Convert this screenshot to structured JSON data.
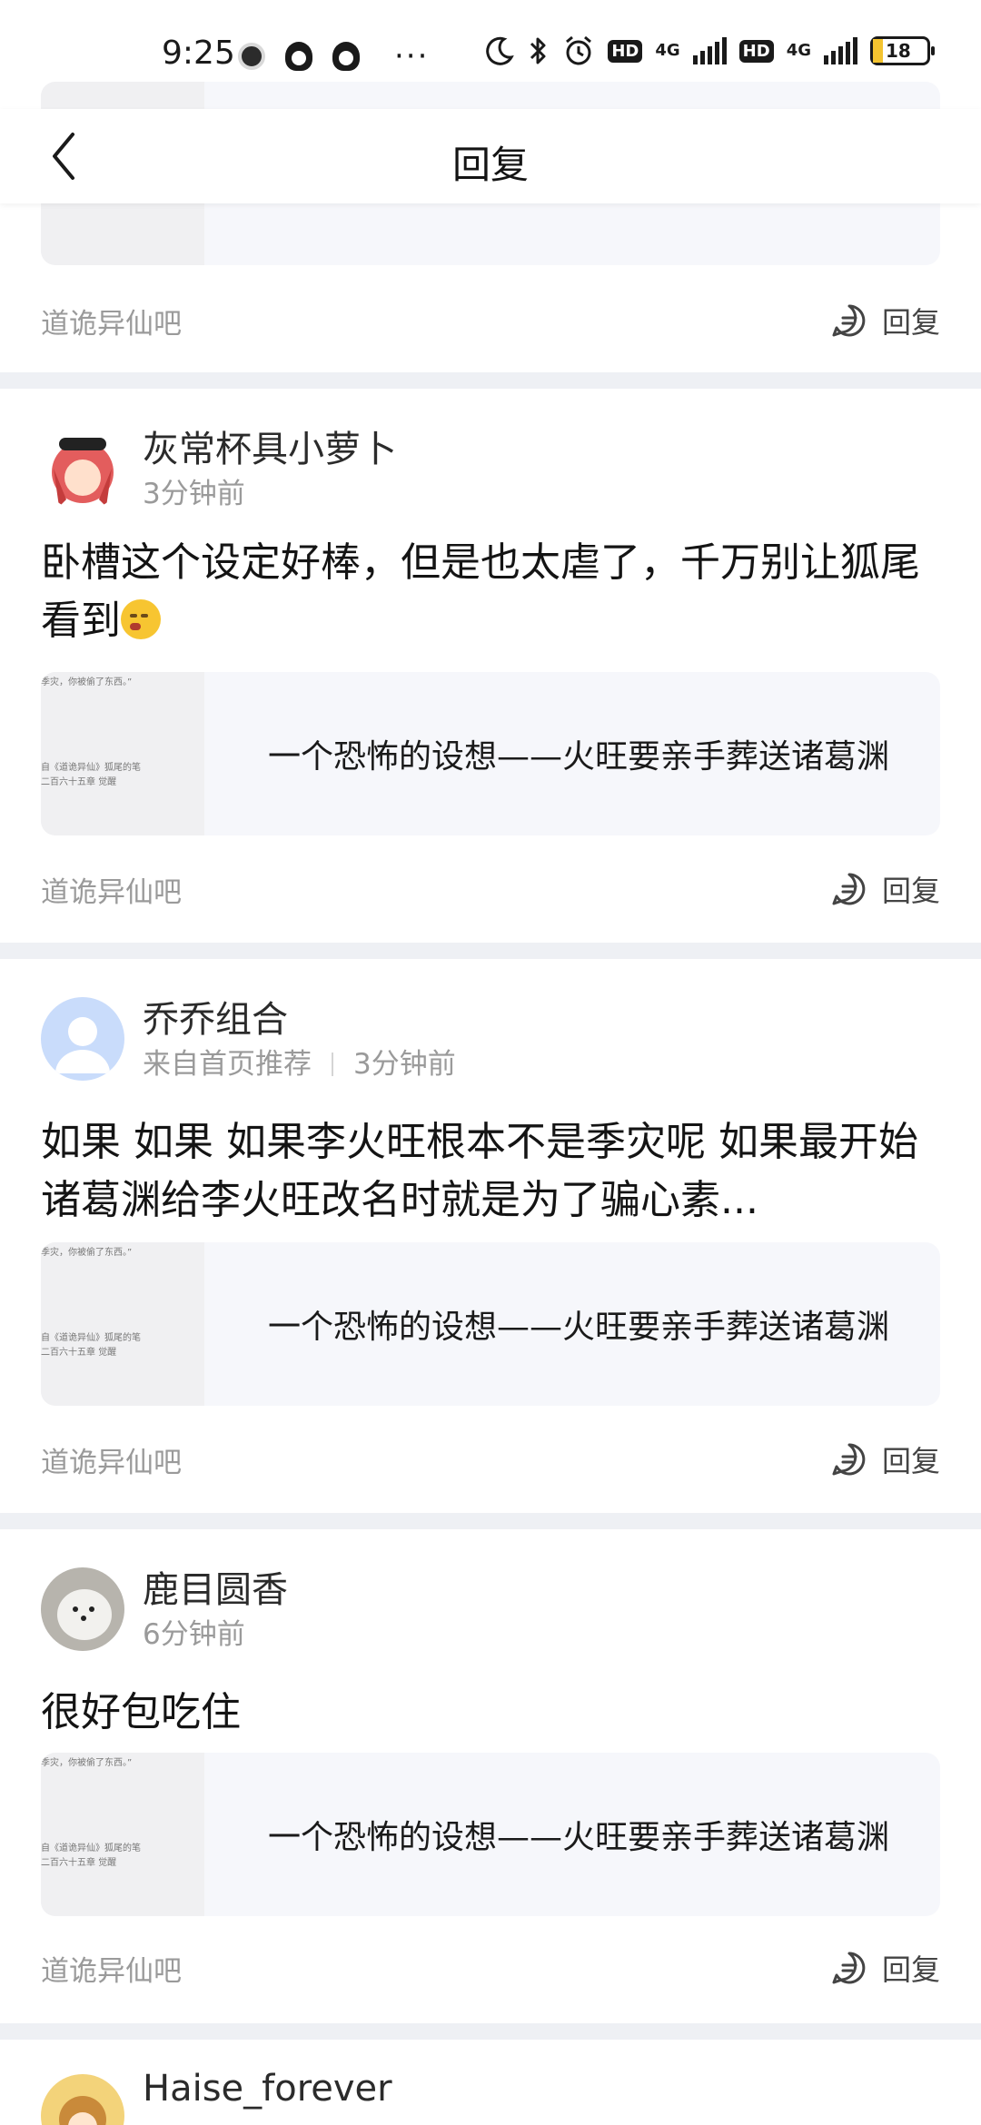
{
  "status_bar": {
    "time": "9:25",
    "more": "···",
    "hd1": "HD",
    "net1": "4G",
    "hd2": "HD",
    "net2": "4G",
    "battery_level": "18",
    "battery_fraction": 0.18
  },
  "header": {
    "title": "回复"
  },
  "quote_thumb": {
    "line1": "季灾，你被偷了东西。”",
    "line2": "自《道诡异仙》狐尾的笔",
    "line3": "二百六十五章 觉醒"
  },
  "cards": [
    {
      "quote_title": "",
      "forum": "道诡异仙吧",
      "reply_label": "回复"
    },
    {
      "username": "灰常杯具小萝卜",
      "source": "",
      "time": "3分钟前",
      "comment": "卧槽这个设定好棒，但是也太虐了，千万别让狐尾看到",
      "quote_title": "一个恐怖的设想——火旺要亲手葬送诸葛渊",
      "forum": "道诡异仙吧",
      "reply_label": "回复"
    },
    {
      "username": "乔乔组合",
      "source": "来自首页推荐",
      "time": "3分钟前",
      "comment": "如果 如果 如果李火旺根本不是季灾呢 如果最开始诸葛渊给李火旺改名时就是为了骗心素...",
      "quote_title": "一个恐怖的设想——火旺要亲手葬送诸葛渊",
      "forum": "道诡异仙吧",
      "reply_label": "回复"
    },
    {
      "username": "鹿目圆香",
      "source": "",
      "time": "6分钟前",
      "comment": "很好包吃住",
      "quote_title": "一个恐怖的设想——火旺要亲手葬送诸葛渊",
      "forum": "道诡异仙吧",
      "reply_label": "回复"
    },
    {
      "username": "Haise_forever"
    }
  ]
}
